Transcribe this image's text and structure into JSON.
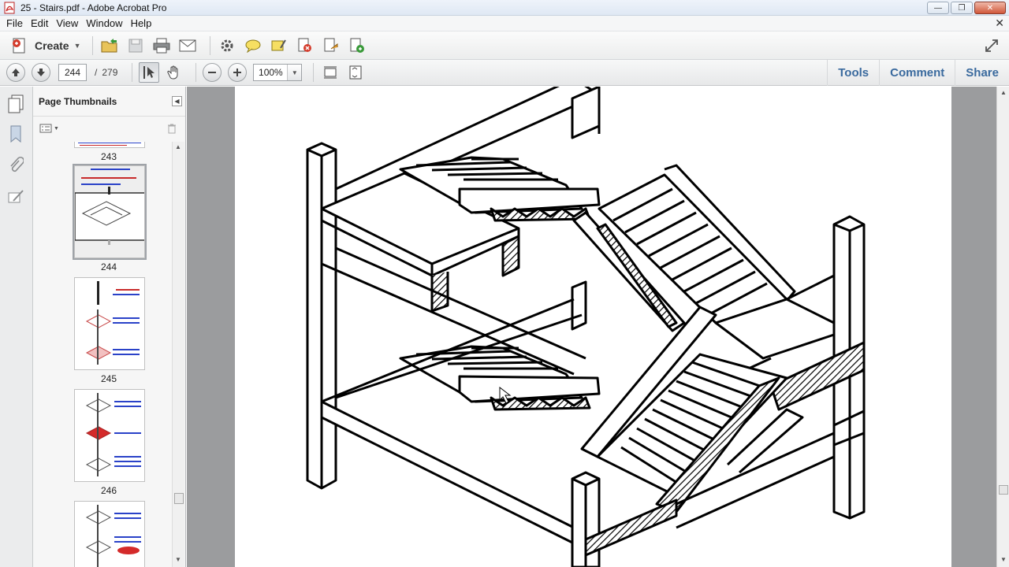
{
  "window": {
    "title": "25 - Stairs.pdf - Adobe Acrobat Pro"
  },
  "menu": {
    "items": [
      "File",
      "Edit",
      "View",
      "Window",
      "Help"
    ]
  },
  "toolbar": {
    "create_label": "Create"
  },
  "navigation": {
    "current_page": "244",
    "separator": "/",
    "total_pages": "279",
    "zoom": "100%"
  },
  "right_links": {
    "tools": "Tools",
    "comment": "Comment",
    "share": "Share"
  },
  "thumbnail_panel": {
    "title": "Page Thumbnails",
    "thumbnails": [
      {
        "page": "243"
      },
      {
        "page": "244"
      },
      {
        "page": "245"
      },
      {
        "page": "246"
      }
    ]
  },
  "colors": {
    "link": "#3a6a9e",
    "doc_background": "#9b9c9e"
  }
}
